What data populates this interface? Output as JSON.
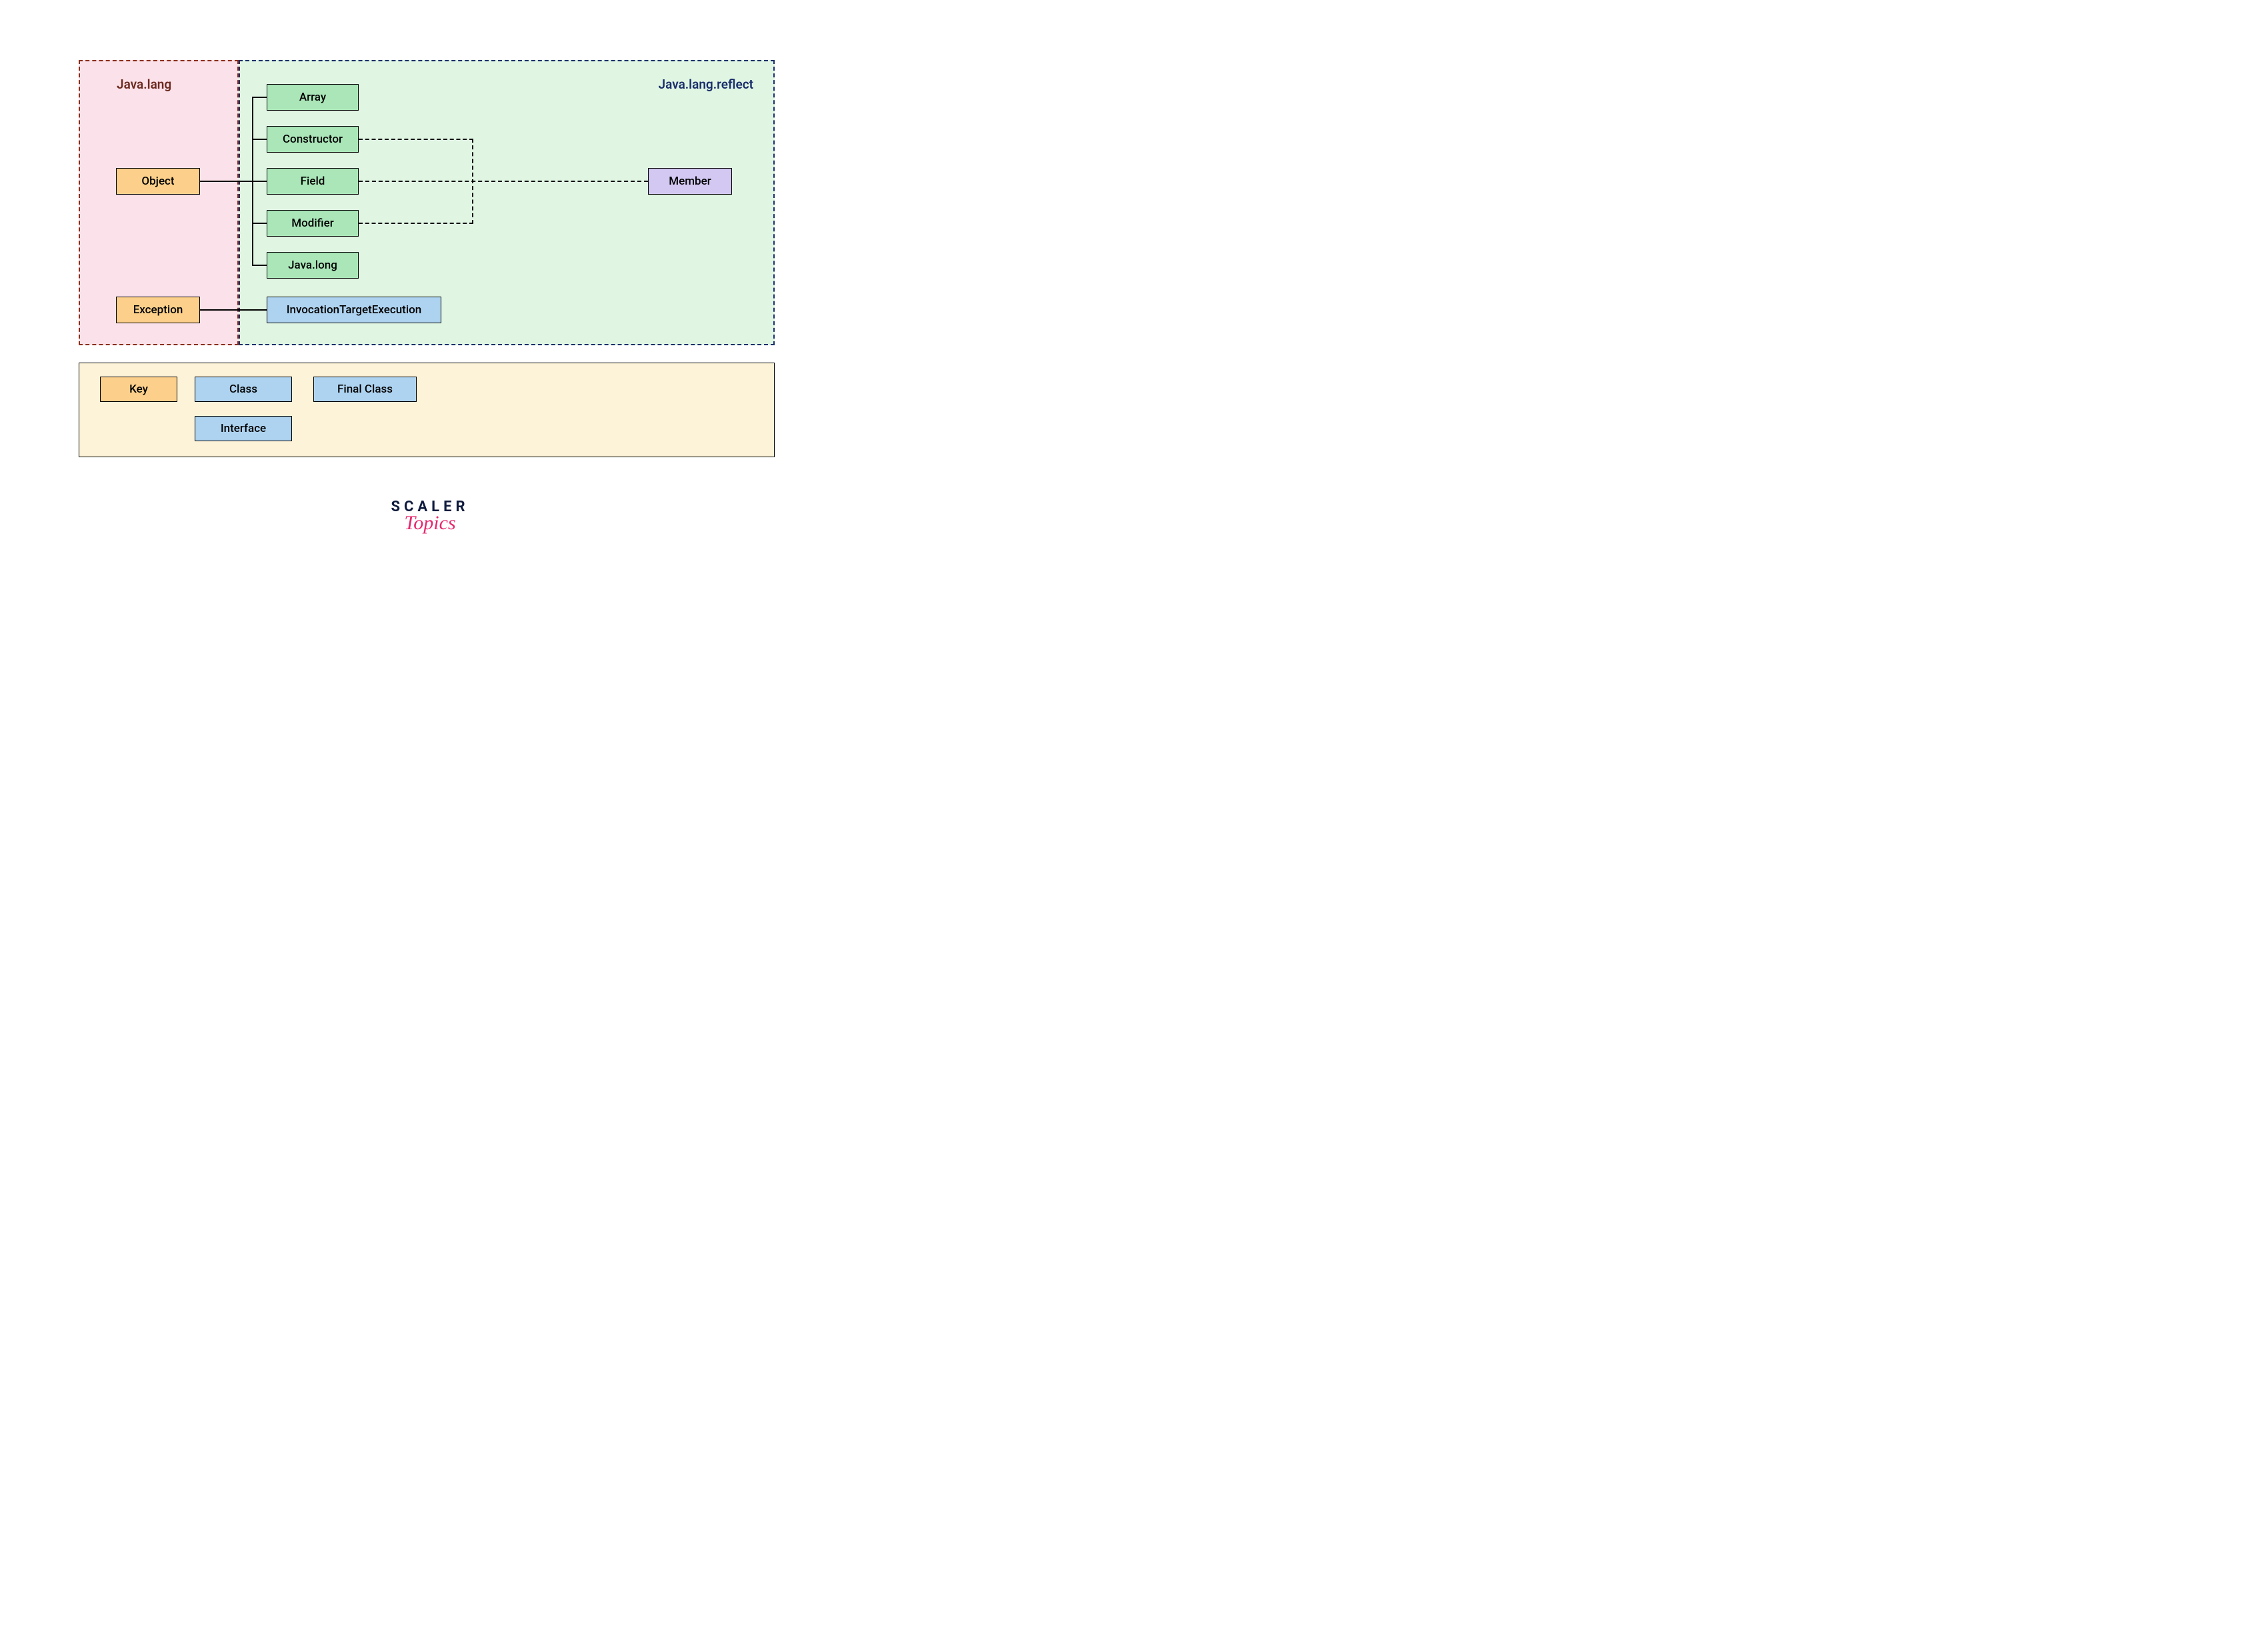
{
  "regions": {
    "lang_label": "Java.lang",
    "reflect_label": "Java.lang.reflect"
  },
  "lang": {
    "object": "Object",
    "exception": "Exception"
  },
  "reflect": {
    "array": "Array",
    "constructor": "Constructor",
    "field": "Field",
    "modifier": "Modifier",
    "javalong": "Java.long",
    "invocation": "InvocationTargetExecution",
    "member": "Member"
  },
  "legend": {
    "key": "Key",
    "class": "Class",
    "final_class": "Final Class",
    "interface": "Interface"
  },
  "branding": {
    "line1": "SCALER",
    "line2": "Topics"
  },
  "colors": {
    "lang_region_bg": "#fbe1e9",
    "lang_region_border": "#8a2e1a",
    "reflect_region_bg": "#e0f6e3",
    "reflect_region_border": "#1a2f6b",
    "orange": "#fcd08b",
    "green": "#aae6b8",
    "blue": "#aed3f0",
    "purple": "#d2c8f2",
    "legend_bg": "#fdf3d9",
    "lang_label_color": "#6b2a1f",
    "reflect_label_color": "#1a2f6b"
  }
}
